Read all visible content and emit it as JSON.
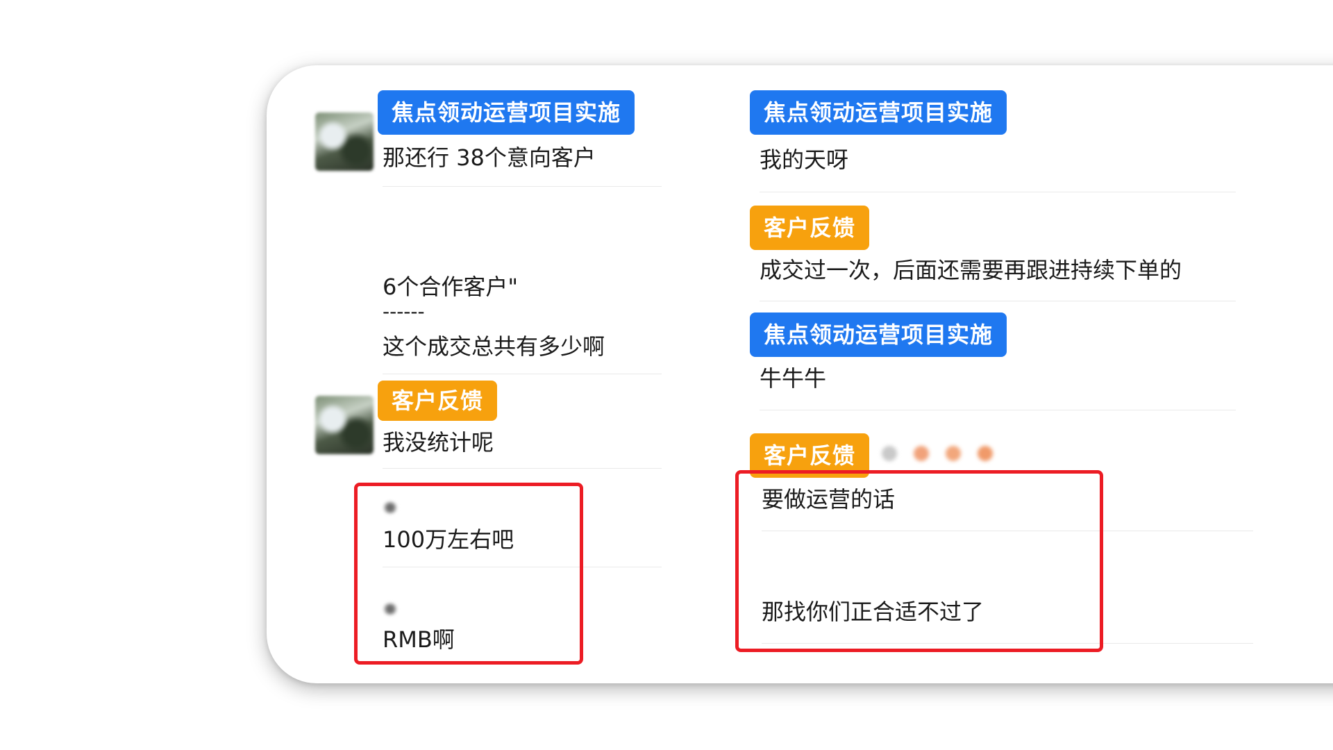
{
  "left_column": {
    "messages": [
      {
        "tag": "焦点领动运营项目实施",
        "tag_color": "#1f78f0",
        "text": "那还行  38个意向客户"
      },
      {
        "tag": "",
        "tag_color": "",
        "text_lines": [
          "6个合作客户\"",
          "------",
          "这个成交总共有多少啊"
        ]
      },
      {
        "tag": "客户反馈",
        "tag_color": "#f7a10e",
        "text": "我没统计呢"
      },
      {
        "tag": "",
        "tag_color": "",
        "text": "100万左右吧"
      },
      {
        "tag": "",
        "tag_color": "",
        "text": "RMB啊"
      }
    ]
  },
  "right_column": {
    "messages": [
      {
        "tag": "焦点领动运营项目实施",
        "tag_color": "#1f78f0",
        "text": "我的天呀"
      },
      {
        "tag": "客户反馈",
        "tag_color": "#f7a10e",
        "text": "成交过一次，后面还需要再跟进持续下单的"
      },
      {
        "tag": "焦点领动运营项目实施",
        "tag_color": "#1f78f0",
        "text": "牛牛牛"
      },
      {
        "tag": "客户反馈",
        "tag_color": "#f7a10e",
        "text": "要做运营的话"
      },
      {
        "tag": "",
        "tag_color": "",
        "text": "那找你们正合适不过了"
      }
    ]
  },
  "colors": {
    "highlight_box": "#ec1c24",
    "blue_tag": "#1f78f0",
    "orange_tag": "#f7a10e"
  }
}
